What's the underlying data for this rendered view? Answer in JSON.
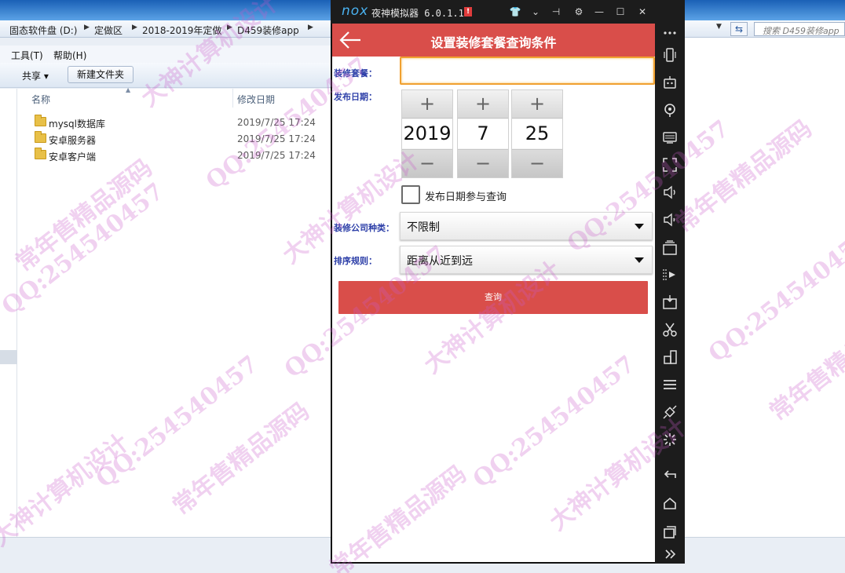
{
  "explorer": {
    "breadcrumbs": [
      "固态软件盘 (D:)",
      "定做区",
      "2018-2019年定做",
      "D459装修app"
    ],
    "search_placeholder": "搜索 D459装修app",
    "menu": [
      "工具(T)",
      "帮助(H)"
    ],
    "toolbar": {
      "share_label": "共享 ▾",
      "new_folder_label": "新建文件夹"
    },
    "columns": {
      "name": "名称",
      "modified": "修改日期"
    },
    "files": [
      {
        "name": "mysql数据库",
        "date": "2019/7/25 17:24"
      },
      {
        "name": "安卓服务器",
        "date": "2019/7/25 17:24"
      },
      {
        "name": "安卓客户端",
        "date": "2019/7/25 17:24"
      }
    ]
  },
  "emulator": {
    "logo": "nox",
    "title": "夜神模拟器 6.0.1.1",
    "alert_badge": "!",
    "side_icons": [
      "more-icon",
      "phone-shake-icon",
      "robot-icon",
      "location-icon",
      "keyboard-icon",
      "fullscreen-icon",
      "volume-up-icon",
      "volume-down-icon",
      "screenshot-icon",
      "screen-record-icon",
      "apk-install-icon",
      "scissors-icon",
      "multi-instance-icon",
      "menu-icon",
      "shake-icon",
      "loading-icon",
      "back-icon",
      "home-icon",
      "recent-apps-icon",
      "expand-icon"
    ]
  },
  "app": {
    "title": "设置装修套餐查询条件",
    "form": {
      "package_label": "装修套餐：",
      "package_value": "",
      "date_label": "发布日期：",
      "year": "2019",
      "month": "7",
      "day": "25",
      "plus": "+",
      "minus": "−",
      "date_check_label": "发布日期参与查询",
      "date_check_checked": false,
      "company_type_label": "装修公司种类：",
      "company_type_value": "不限制",
      "sort_label": "排序规则：",
      "sort_value": "距离从近到远",
      "query_button": "查询"
    },
    "colors": {
      "header": "#d94e4a",
      "label": "#2d3fa8",
      "input_focus": "#f0a030"
    }
  },
  "watermarks": [
    "QQ:254540457",
    "大神计算机设计",
    "常年售精品源码"
  ]
}
